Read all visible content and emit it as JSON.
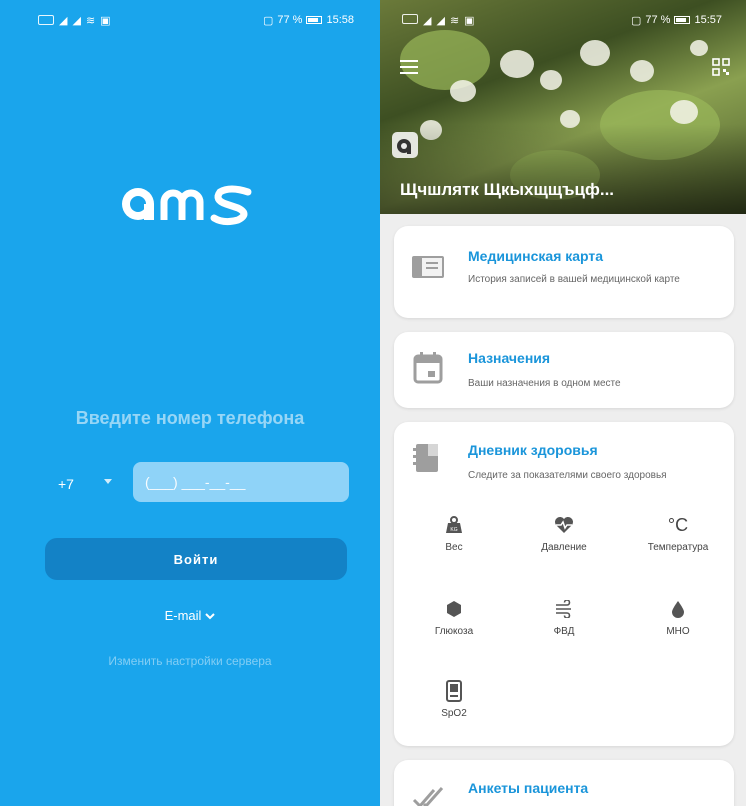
{
  "left_screen": {
    "status_bar": {
      "battery": "77 %",
      "time": "15:58"
    },
    "phone_prompt": "Введите номер телефона",
    "country_code": "+7",
    "phone_placeholder": "(___) ___-__-__",
    "login_button": "Войти",
    "email_toggle": "E-mail",
    "server_settings_link": "Изменить настройки сервера",
    "colors": {
      "background": "#1aa5ec",
      "button": "#1382c6",
      "input": "#8fd3f8"
    }
  },
  "right_screen": {
    "status_bar": {
      "battery": "77 %",
      "time": "15:57"
    },
    "user_name": "Щчшлятк Щкыхщщъцф...",
    "cards": {
      "medical_record": {
        "title": "Медицинская карта",
        "subtitle": "История записей в вашей медицинской карте",
        "icon": "medical-card-icon"
      },
      "appointments": {
        "title": "Назначения",
        "subtitle": "Ваши назначения в одном месте",
        "icon": "calendar-icon"
      },
      "health_diary": {
        "title": "Дневник здоровья",
        "subtitle": "Следите за показателями своего здоровья",
        "icon": "diary-icon",
        "metrics": [
          {
            "label": "Вес",
            "icon": "weight-icon"
          },
          {
            "label": "Давление",
            "icon": "heart-pulse-icon"
          },
          {
            "label": "Температура",
            "icon": "celsius-icon"
          },
          {
            "label": "Глюкоза",
            "icon": "glucose-icon"
          },
          {
            "label": "ФВД",
            "icon": "wind-icon"
          },
          {
            "label": "МНО",
            "icon": "drop-icon"
          },
          {
            "label": "SpO2",
            "icon": "oximeter-icon"
          }
        ]
      },
      "questionnaires": {
        "title": "Анкеты пациента",
        "icon": "checkmarks-icon"
      }
    },
    "colors": {
      "accent": "#1a95da",
      "background": "#eeeeee"
    }
  }
}
